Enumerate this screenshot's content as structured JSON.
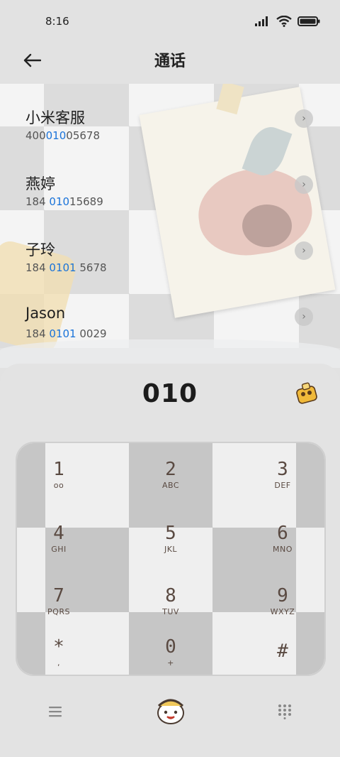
{
  "status_bar": {
    "time": "8:16"
  },
  "header": {
    "title": "通话"
  },
  "contacts": [
    {
      "name": "小米客服",
      "number_pre": "400",
      "number_hl": "010",
      "number_post": "05678"
    },
    {
      "name": "燕婷",
      "number_pre": "184 ",
      "number_hl": "010",
      "number_post": "15689"
    },
    {
      "name": "子玲",
      "number_pre": "184 ",
      "number_hl": "0101",
      "number_post": " 5678"
    },
    {
      "name": "Jason",
      "number_pre": "184 ",
      "number_hl": "0101",
      "number_post": " 0029"
    }
  ],
  "dialer": {
    "entered": "010",
    "keys": [
      {
        "digit": "1",
        "letters": "oo"
      },
      {
        "digit": "2",
        "letters": "ABC"
      },
      {
        "digit": "3",
        "letters": "DEF"
      },
      {
        "digit": "4",
        "letters": "GHI"
      },
      {
        "digit": "5",
        "letters": "JKL"
      },
      {
        "digit": "6",
        "letters": "MNO"
      },
      {
        "digit": "7",
        "letters": "PQRS"
      },
      {
        "digit": "8",
        "letters": "TUV"
      },
      {
        "digit": "9",
        "letters": "WXYZ"
      },
      {
        "digit": "*",
        "letters": ","
      },
      {
        "digit": "0",
        "letters": "+"
      },
      {
        "digit": "#",
        "letters": ""
      }
    ]
  },
  "bottom_nav": {
    "left_icon": "menu-icon",
    "center_icon": "call-sticker-icon",
    "right_icon": "dialpad-icon"
  },
  "colors": {
    "highlight": "#1a73d9",
    "key_text": "#5a4a42"
  }
}
